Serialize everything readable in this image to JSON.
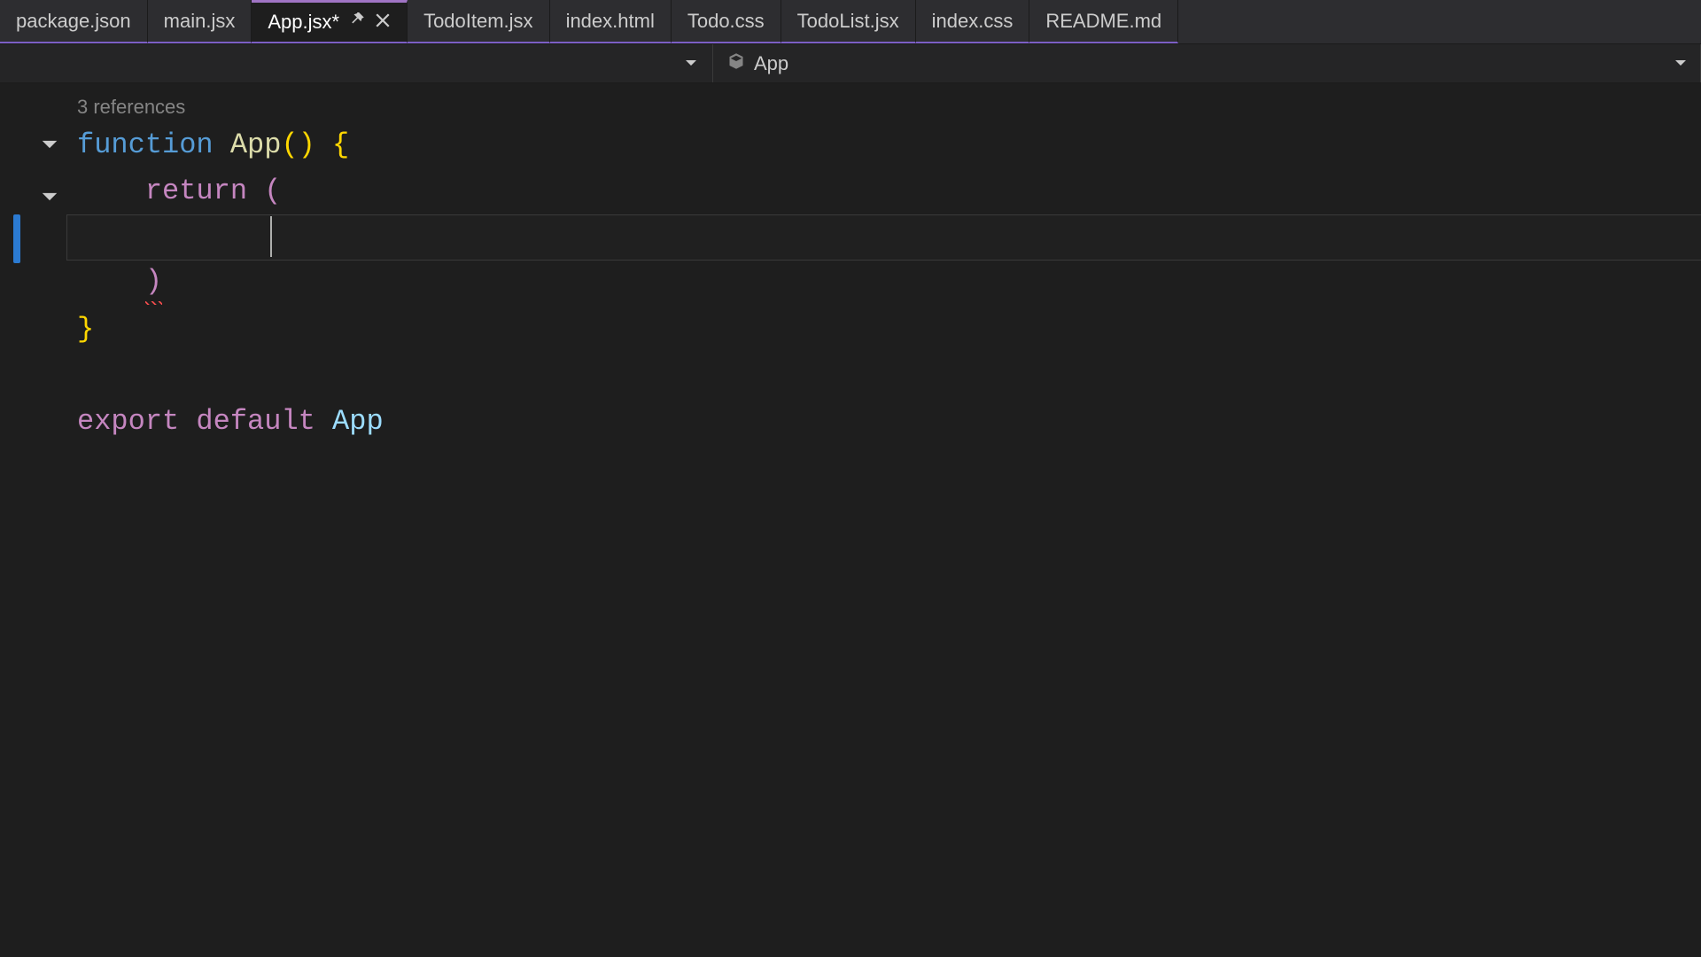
{
  "tabs": [
    {
      "label": "package.json",
      "active": false
    },
    {
      "label": "main.jsx",
      "active": false
    },
    {
      "label": "App.jsx*",
      "active": true
    },
    {
      "label": "TodoItem.jsx",
      "active": false
    },
    {
      "label": "index.html",
      "active": false
    },
    {
      "label": "Todo.css",
      "active": false
    },
    {
      "label": "TodoList.jsx",
      "active": false
    },
    {
      "label": "index.css",
      "active": false
    },
    {
      "label": "README.md",
      "active": false
    }
  ],
  "breadcrumb": {
    "symbol": "App"
  },
  "codelens": "3 references",
  "code": {
    "kw_function": "function",
    "fn_name": "App",
    "parens_open": "(",
    "parens_close": ")",
    "brace_open": "{",
    "brace_close": "}",
    "kw_return": "return",
    "ret_paren_open": "(",
    "ret_paren_close": ")",
    "kw_export": "export",
    "kw_default": "default",
    "ident_app": "App"
  }
}
